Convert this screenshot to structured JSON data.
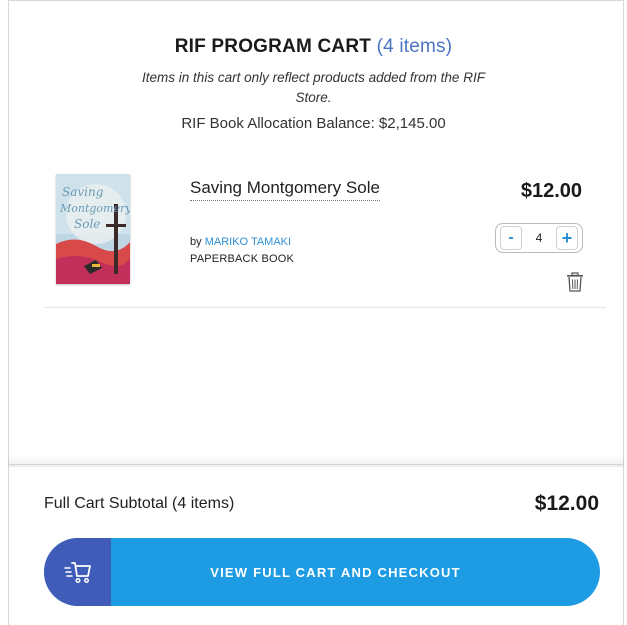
{
  "cart": {
    "title": "RIF PROGRAM CART",
    "item_count_label": "(4 items)",
    "notice": "Items in this cart only reflect products added from the RIF Store.",
    "balance": "RIF Book Allocation Balance: $2,145.00"
  },
  "item": {
    "title": "Saving Montgomery Sole",
    "by_label": "by",
    "author": "MARIKO TAMAKI",
    "format": "PAPERBACK BOOK",
    "price": "$12.00",
    "quantity": "4",
    "minus_label": "-",
    "plus_label": "+",
    "cover_text": "Saving Montgomery Sole"
  },
  "footer": {
    "subtotal_label": "Full Cart Subtotal (4 items)",
    "subtotal_value": "$12.00",
    "checkout_label": "VIEW FULL CART AND CHECKOUT"
  },
  "icons": {
    "trash": "trash-icon",
    "cart": "cart-icon"
  },
  "colors": {
    "accent_blue": "#1d9be3",
    "dark_blue": "#3e5cb8",
    "link_blue": "#2f8fd6",
    "count_blue": "#4a73c6"
  }
}
